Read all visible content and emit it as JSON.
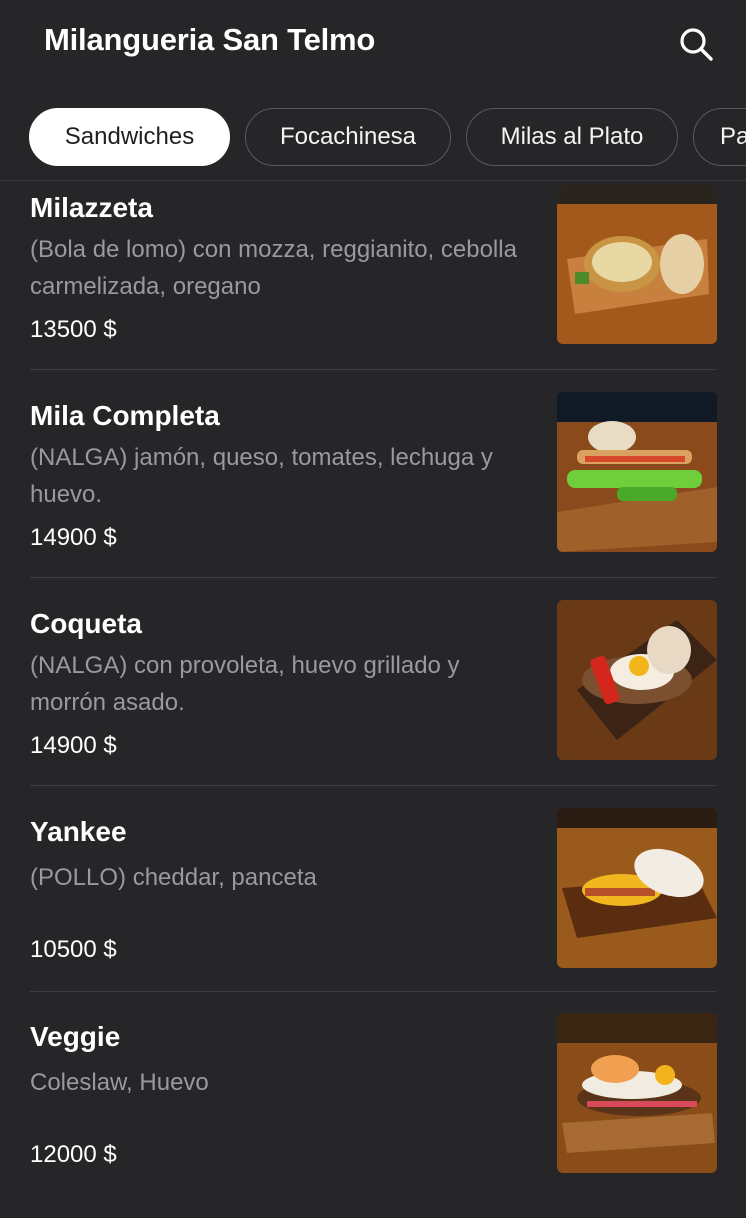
{
  "header": {
    "title": "Milangueria San Telmo",
    "search_icon": "search-icon"
  },
  "tabs": [
    {
      "label": "Sandwiches",
      "active": true
    },
    {
      "label": "Focachinesa",
      "active": false
    },
    {
      "label": "Milas al Plato",
      "active": false
    },
    {
      "label": "Pa",
      "active": false
    }
  ],
  "menu": {
    "items": [
      {
        "name": "Milazzeta",
        "description": "(Bola de lomo) con mozza, reggianito, cebolla carmelizada, oregano",
        "price": "13500 $"
      },
      {
        "name": "Mila Completa",
        "description": "(NALGA) jamón, queso, tomates, lechuga y huevo.",
        "price": "14900 $"
      },
      {
        "name": "Coqueta",
        "description": "(NALGA) con provoleta, huevo grillado y morrón asado.",
        "price": "14900 $"
      },
      {
        "name": "Yankee",
        "description": "(POLLO) cheddar, panceta",
        "price": "10500 $"
      },
      {
        "name": "Veggie",
        "description": "Coleslaw, Huevo",
        "price": "12000 $"
      }
    ]
  },
  "colors": {
    "background": "#262528",
    "muted_text": "#9a99a0",
    "active_tab_bg": "#ffffff"
  }
}
